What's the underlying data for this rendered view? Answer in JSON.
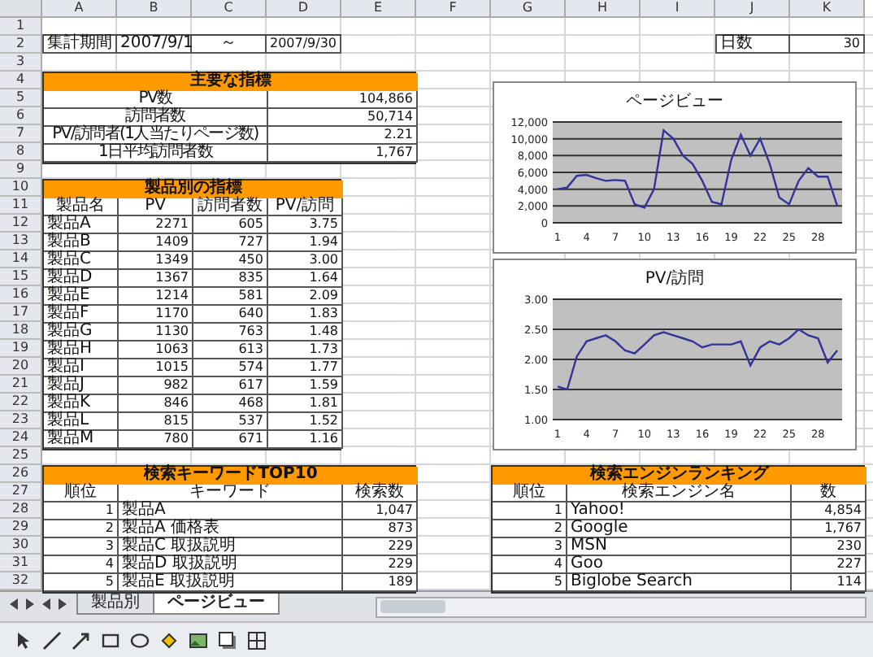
{
  "columns": [
    "A",
    "B",
    "C",
    "D",
    "E",
    "F",
    "G",
    "H",
    "I",
    "J",
    "K"
  ],
  "row_numbers": [
    "1",
    "2",
    "3",
    "4",
    "5",
    "6",
    "7",
    "8",
    "9",
    "10",
    "11",
    "12",
    "13",
    "14",
    "15",
    "16",
    "17",
    "18",
    "19",
    "20",
    "21",
    "22",
    "23",
    "24",
    "25",
    "26",
    "27",
    "28",
    "29",
    "30",
    "31",
    "32"
  ],
  "period": {
    "label": "集計期間",
    "start": "2007/9/1",
    "separator": "～",
    "end": "2007/9/30"
  },
  "days": {
    "label": "日数",
    "value": "30"
  },
  "key_metrics": {
    "title": "主要な指標",
    "rows": [
      {
        "label": "PV数",
        "value": "104,866"
      },
      {
        "label": "訪問者数",
        "value": "50,714"
      },
      {
        "label": "PV/訪問者(1人当たりページ数)",
        "value": "2.21"
      },
      {
        "label": "1日平均訪問者数",
        "value": "1,767"
      }
    ]
  },
  "product_metrics": {
    "title": "製品別の指標",
    "columns": [
      "製品名",
      "PV",
      "訪問者数",
      "PV/訪問"
    ],
    "rows": [
      [
        "製品A",
        "2271",
        "605",
        "3.75"
      ],
      [
        "製品B",
        "1409",
        "727",
        "1.94"
      ],
      [
        "製品C",
        "1349",
        "450",
        "3.00"
      ],
      [
        "製品D",
        "1367",
        "835",
        "1.64"
      ],
      [
        "製品E",
        "1214",
        "581",
        "2.09"
      ],
      [
        "製品F",
        "1170",
        "640",
        "1.83"
      ],
      [
        "製品G",
        "1130",
        "763",
        "1.48"
      ],
      [
        "製品H",
        "1063",
        "613",
        "1.73"
      ],
      [
        "製品I",
        "1015",
        "574",
        "1.77"
      ],
      [
        "製品J",
        "982",
        "617",
        "1.59"
      ],
      [
        "製品K",
        "846",
        "468",
        "1.81"
      ],
      [
        "製品L",
        "815",
        "537",
        "1.52"
      ],
      [
        "製品M",
        "780",
        "671",
        "1.16"
      ]
    ]
  },
  "keyword_ranking": {
    "title": "検索キーワードTOP10",
    "columns": [
      "順位",
      "キーワード",
      "検索数"
    ],
    "rows": [
      [
        "1",
        "製品A",
        "1,047"
      ],
      [
        "2",
        "製品A 価格表",
        "873"
      ],
      [
        "3",
        "製品C 取扱説明",
        "229"
      ],
      [
        "4",
        "製品D 取扱説明",
        "229"
      ],
      [
        "5",
        "製品E 取扱説明",
        "189"
      ]
    ]
  },
  "engine_ranking": {
    "title": "検索エンジンランキング",
    "columns": [
      "順位",
      "検索エンジン名",
      "数"
    ],
    "rows": [
      [
        "1",
        "Yahoo!",
        "4,854"
      ],
      [
        "2",
        "Google",
        "1,767"
      ],
      [
        "3",
        "MSN",
        "230"
      ],
      [
        "4",
        "Goo",
        "227"
      ],
      [
        "5",
        "Biglobe Search",
        "114"
      ]
    ]
  },
  "charts": [
    {
      "chart_data": {
        "type": "line",
        "title": "ページビュー",
        "x": [
          1,
          2,
          3,
          4,
          5,
          6,
          7,
          8,
          9,
          10,
          11,
          12,
          13,
          14,
          15,
          16,
          17,
          18,
          19,
          20,
          21,
          22,
          23,
          24,
          25,
          26,
          27,
          28,
          29,
          30
        ],
        "xticks": [
          1,
          4,
          7,
          10,
          13,
          16,
          19,
          22,
          25,
          28
        ],
        "ylim": [
          0,
          12000
        ],
        "yticks": [
          {
            "value": 0,
            "label": "0"
          },
          {
            "value": 2000,
            "label": "2,000"
          },
          {
            "value": 4000,
            "label": "4,000"
          },
          {
            "value": 6000,
            "label": "6,000"
          },
          {
            "value": 8000,
            "label": "8,000"
          },
          {
            "value": 10000,
            "label": "10,000"
          },
          {
            "value": 12000,
            "label": "12,000"
          }
        ],
        "xlim": [
          0.5,
          30.5
        ],
        "grid": true,
        "series": [
          {
            "color": "#333399",
            "values": [
              4000,
              4200,
              5600,
              5700,
              5300,
              5000,
              5100,
              5000,
              2200,
              1800,
              4000,
              11000,
              10000,
              8000,
              7000,
              5000,
              2500,
              2200,
              7500,
              10500,
              8000,
              10000,
              7000,
              3000,
              2200,
              5000,
              6500,
              5500,
              5500,
              2000
            ]
          }
        ]
      }
    },
    {
      "chart_data": {
        "type": "line",
        "title": "PV/訪問",
        "x": [
          1,
          2,
          3,
          4,
          5,
          6,
          7,
          8,
          9,
          10,
          11,
          12,
          13,
          14,
          15,
          16,
          17,
          18,
          19,
          20,
          21,
          22,
          23,
          24,
          25,
          26,
          27,
          28,
          29,
          30
        ],
        "xticks": [
          1,
          4,
          7,
          10,
          13,
          16,
          19,
          22,
          25,
          28
        ],
        "ylim": [
          1,
          3
        ],
        "yticks": [
          {
            "value": 1,
            "label": "1.00"
          },
          {
            "value": 1.5,
            "label": "1.50"
          },
          {
            "value": 2,
            "label": "2.00"
          },
          {
            "value": 2.5,
            "label": "2.50"
          },
          {
            "value": 3,
            "label": "3.00"
          }
        ],
        "xlim": [
          0.5,
          30.5
        ],
        "grid": true,
        "series": [
          {
            "color": "#333399",
            "values": [
              1.55,
              1.5,
              2.05,
              2.3,
              2.35,
              2.4,
              2.3,
              2.15,
              2.1,
              2.25,
              2.4,
              2.45,
              2.4,
              2.35,
              2.3,
              2.2,
              2.25,
              2.25,
              2.25,
              2.3,
              1.9,
              2.2,
              2.3,
              2.25,
              2.35,
              2.5,
              2.4,
              2.35,
              1.95,
              2.15
            ]
          }
        ]
      }
    }
  ],
  "sheet_tabs": [
    {
      "label": "製品別",
      "selected": false
    },
    {
      "label": "ページビュー",
      "selected": true
    }
  ]
}
